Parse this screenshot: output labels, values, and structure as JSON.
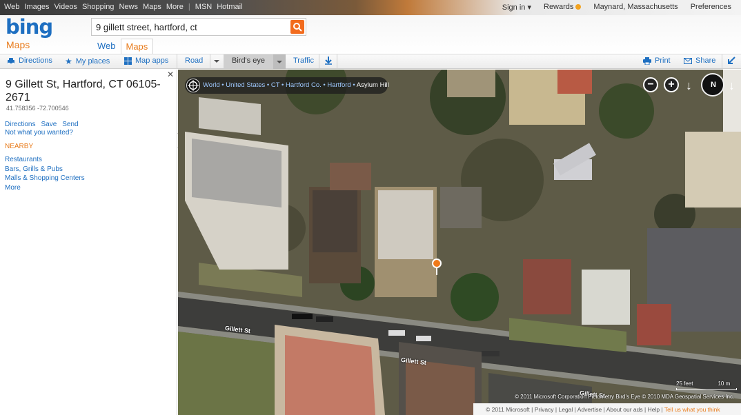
{
  "topnav": {
    "links": [
      "Web",
      "Images",
      "Videos",
      "Shopping",
      "News",
      "Maps",
      "More"
    ],
    "extra": [
      "MSN",
      "Hotmail"
    ],
    "signin": "Sign in ▾",
    "rewards": "Rewards",
    "location": "Maynard, Massachusetts",
    "preferences": "Preferences"
  },
  "header": {
    "logo": "bing",
    "product": "Maps",
    "search_value": "9 gillett street, hartford, ct",
    "tabs": [
      "Web",
      "Maps"
    ],
    "active_tab": "Maps"
  },
  "toolbar": {
    "directions": "Directions",
    "my_places": "My places",
    "map_apps": "Map apps",
    "road": "Road",
    "birds_eye": "Bird's eye",
    "traffic": "Traffic",
    "print": "Print",
    "share": "Share"
  },
  "result": {
    "address": "9 Gillett St, Hartford, CT 06105-2671",
    "coords": "41.758356 -72.700546",
    "actions": [
      "Directions",
      "Save",
      "Send"
    ],
    "not_what": "Not what you wanted?",
    "nearby_heading": "NEARBY",
    "nearby": [
      "Restaurants",
      "Bars, Grills & Pubs",
      "Malls & Shopping Centers",
      "More"
    ]
  },
  "map": {
    "breadcrumb": [
      "World",
      "United States",
      "CT",
      "Hartford Co.",
      "Hartford"
    ],
    "breadcrumb_current": "Asylum Hill",
    "compass_label": "N",
    "streets": [
      "Gillett St",
      "Gillett St",
      "Gillett St"
    ],
    "scale_feet": "25 feet",
    "scale_m": "10 m",
    "copyright": "© 2011 Microsoft Corporation  Pictometry Bird's Eye © 2010 MDA Geospatial Services Inc.",
    "footer": [
      "© 2011 Microsoft",
      "Privacy",
      "Legal",
      "Advertise",
      "About our ads",
      "Help"
    ],
    "footer_feedback": "Tell us what you think"
  }
}
